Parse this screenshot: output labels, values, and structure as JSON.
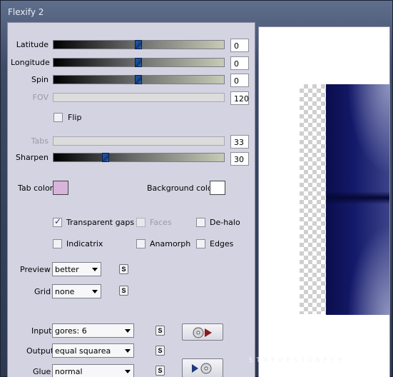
{
  "window": {
    "title": "Flexify 2"
  },
  "sliders": {
    "latitude": {
      "label": "Latitude",
      "value": "0",
      "position": 0.5
    },
    "longitude": {
      "label": "Longitude",
      "value": "0",
      "position": 0.5
    },
    "spin": {
      "label": "Spin",
      "value": "0",
      "position": 0.5
    },
    "fov": {
      "label": "FOV",
      "value": "120",
      "position": null
    },
    "tabs": {
      "label": "Tabs",
      "value": "33",
      "position": null
    },
    "sharpen": {
      "label": "Sharpen",
      "value": "30",
      "position": 0.3
    }
  },
  "flip": {
    "label": "Flip",
    "checked": false
  },
  "colors": {
    "tab_color_label": "Tab color",
    "tab_color": "#d8b4dc",
    "background_color_label": "Background color",
    "background_color": "#ffffff"
  },
  "options": {
    "transparent_gaps": {
      "label": "Transparent gaps",
      "checked": true
    },
    "faces": {
      "label": "Faces",
      "checked": false
    },
    "de_halo": {
      "label": "De-halo",
      "checked": false
    },
    "indicatrix": {
      "label": "Indicatrix",
      "checked": false
    },
    "anamorph": {
      "label": "Anamorph",
      "checked": false
    },
    "edges": {
      "label": "Edges",
      "checked": false
    }
  },
  "preview": {
    "label": "Preview",
    "value": "better"
  },
  "grid": {
    "label": "Grid",
    "value": "none"
  },
  "input": {
    "label": "Input",
    "value": "gores: 6"
  },
  "output": {
    "label": "Output",
    "value": "equal squarea"
  },
  "glue": {
    "label": "Glue",
    "value": "normal"
  },
  "s_button_label": "S",
  "watermark": "STARDESIGNPSP",
  "accent": {
    "thumb": "#1d57a8",
    "navy": "#0a0d4c"
  }
}
